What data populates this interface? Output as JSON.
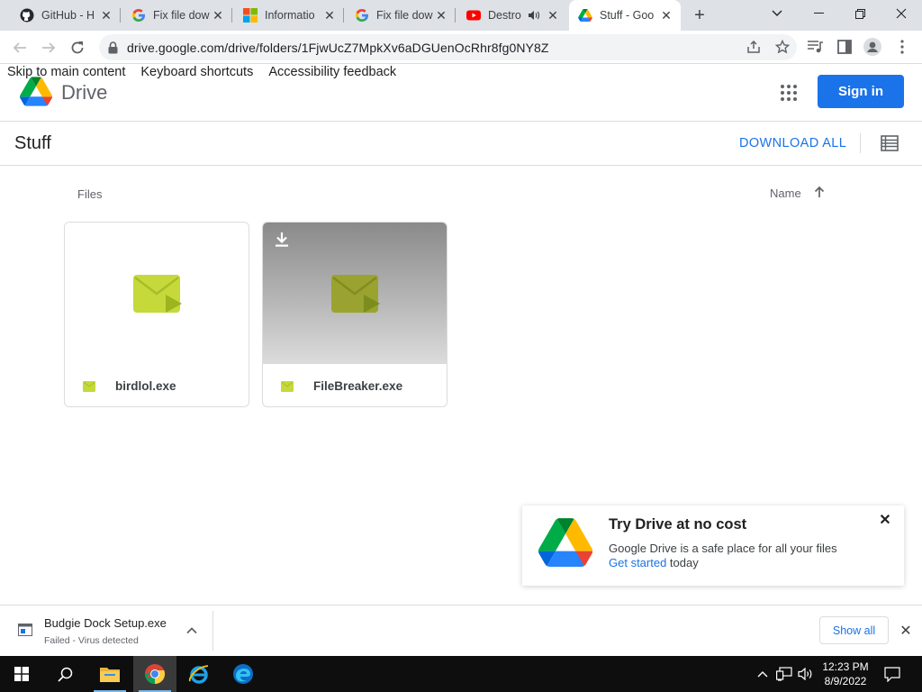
{
  "browser": {
    "tabs": [
      {
        "title": "GitHub - H",
        "favicon": "github-icon"
      },
      {
        "title": "Fix file dow",
        "favicon": "google-icon"
      },
      {
        "title": "Informatio",
        "favicon": "microsoft-icon"
      },
      {
        "title": "Fix file dow",
        "favicon": "google-icon"
      },
      {
        "title": "Destro",
        "favicon": "youtube-icon"
      },
      {
        "title": "Stuff - Goo",
        "favicon": "drive-icon",
        "active": true
      }
    ],
    "url": "drive.google.com/drive/folders/1FjwUcZ7MpkXv6aDGUenOcRhr8fg0NY8Z"
  },
  "drive": {
    "skip_links": [
      "Skip to main content",
      "Keyboard shortcuts",
      "Accessibility feedback"
    ],
    "brand": "Drive",
    "sign_in": "Sign in",
    "folder_title": "Stuff",
    "download_all": "DOWNLOAD ALL",
    "files_label": "Files",
    "sort_label": "Name",
    "files": [
      {
        "name": "birdlol.exe"
      },
      {
        "name": "FileBreaker.exe"
      }
    ]
  },
  "promo": {
    "title": "Try Drive at no cost",
    "text": "Google Drive is a safe place for all your files",
    "link": "Get started",
    "suffix": " today"
  },
  "download_shelf": {
    "file_name": "Budgie Dock Setup.exe",
    "status": "Failed - Virus detected",
    "show_all": "Show all"
  },
  "taskbar": {
    "time": "12:23 PM",
    "date": "8/9/2022"
  },
  "colors": {
    "accent": "#1a73e8",
    "file_icon": "#c5d93a"
  }
}
